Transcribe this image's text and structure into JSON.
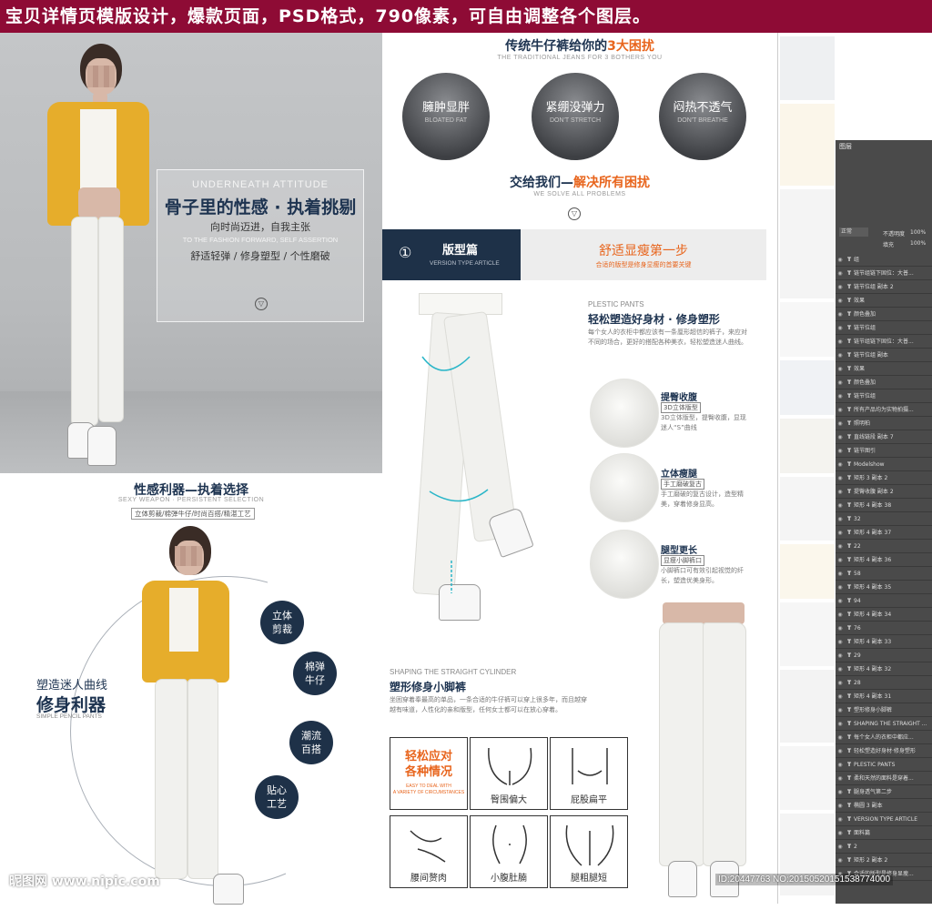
{
  "banner": {
    "text": "宝贝详情页模版设计，爆款页面，PSD格式，790像素，可自由调整各个图层。"
  },
  "hero": {
    "en_title": "UNDERNEATH ATTITUDE",
    "title": "骨子里的性感 · 执着挑剔",
    "sub1": "向时尚迈进，自我主张",
    "en_sub": "TO THE FASHION FORWARD, SELF ASSERTION",
    "sub2": "舒适轻弹 / 修身塑型 / 个性磨破",
    "btn": "▽"
  },
  "problems": {
    "title_a": "传统牛仔裤给你的",
    "title_b": "3大困扰",
    "en": "THE TRADITIONAL JEANS FOR 3 BOTHERS YOU",
    "items": [
      {
        "cn": "臃肿显胖",
        "en": "BLOATED FAT"
      },
      {
        "cn": "紧绷没弹力",
        "en": "DON'T STRETCH"
      },
      {
        "cn": "闷热不透气",
        "en": "DON'T BREATHE"
      }
    ],
    "solve_a": "交给我们—",
    "solve_b": "解决所有困扰",
    "solve_en": "WE SOLVE ALL PROBLEMS",
    "btn": "▽"
  },
  "version": {
    "num": "①",
    "title": "版型篇",
    "en": "VERSION TYPE ARTICLE",
    "right_title": "舒适显瘦第一步",
    "right_sub": "合适的版型是修身显瘦的首要关键"
  },
  "plastic": {
    "en": "PLESTIC PANTS",
    "title": "轻松塑造好身材 · 修身塑形",
    "body": "每个女人的衣柜中都应该有一条厘形超信的裤子，来应对不同的场合，更好的搭配各种美衣，轻松塑造迷人曲线。"
  },
  "details": [
    {
      "title": "提臀收腹",
      "tag": "3D立体版型",
      "body": "3D立体版型，提臀收腹，显现迷人“S”曲线"
    },
    {
      "title": "立体瘦腿",
      "tag": "手工磨破复古",
      "body": "手工磨破的复古设计，造型精美，穿着修身显高。"
    },
    {
      "title": "腿型更长",
      "tag": "显瘦小脚裤口",
      "body": "小脚裤口可有效引起视觉的纤长，塑造优美身形。"
    }
  ],
  "straight": {
    "en": "SHAPING THE STRAIGHT CYLINDER",
    "title": "塑形修身小脚裤",
    "body": "坐困穿着奉最高的单品，一条合适的牛仔裤可以穿上很多年，而且越穿越有味道，人性化的亲和版型，任何女士都可以在放心穿着。"
  },
  "easy": {
    "title1": "轻松应对",
    "title2": "各种情况",
    "en1": "EASY TO DEAL WITH",
    "en2": "A VARIETY OF CIRCUMSTANCES"
  },
  "grid": [
    "臀围偏大",
    "屁股扁平",
    "腰间赘肉",
    "小腹肚腩",
    "腿粗腿短"
  ],
  "sexy": {
    "title": "性感利器—执着选择",
    "en": "SEXY WEAPON · PERSISTENT SELECTION",
    "tag": "立体剪裁/棉弹牛仔/时尚百搭/精湛工艺",
    "curve_cn": "塑造迷人曲线",
    "curve_big": "修身利器",
    "curve_en": "SIMPLE PENCIL PANTS",
    "badges": [
      {
        "l1": "立体",
        "l2": "剪裁"
      },
      {
        "l1": "棉弹",
        "l2": "牛仔"
      },
      {
        "l1": "潮流",
        "l2": "百搭"
      },
      {
        "l1": "贴心",
        "l2": "工艺"
      }
    ]
  },
  "ps_panel": {
    "header": "图层",
    "mode": "正常",
    "opacity_label": "不透明度",
    "opacity": "100%",
    "fill_label": "填充",
    "fill": "100%",
    "layers": [
      "组",
      "链节组链下固位：大普...",
      "链节位组 副本 2",
      "效果",
      "颜色叠加",
      "链节位组",
      "链节组链下固位：大普...",
      "链节位组 副本",
      "效果",
      "颜色叠加",
      "链节位组",
      "所有产品均为实物拍摄...",
      "照明柏",
      "直线链段 副本 7",
      "链节图引",
      "Modelshow",
      "矩形 3 副本 2",
      "提臀收腹 副本 2",
      "矩形 4 副本 38",
      "32",
      "矩形 4 副本 37",
      "22",
      "矩形 4 副本 36",
      "58",
      "矩形 4 副本 35",
      "94",
      "矩形 4 副本 34",
      "76",
      "矩形 4 副本 33",
      "29",
      "矩形 4 副本 32",
      "28",
      "矩形 4 副本 31",
      "塑形修身小脚裤",
      "SHAPING THE STRAIGHT ...",
      "每个女人的衣柜中都应...",
      "轻松塑造好身材·修身塑形",
      "PLESTIC PANTS",
      "柔和天然的面料是穿着...",
      "腿身透气第二步",
      "椭圆 3 副本",
      "VERSION TYPE ARTICLE",
      "面料篇",
      "2",
      "矩形 2 副本 2",
      "合适的版型是修身显瘦..."
    ]
  },
  "watermark": {
    "left": "昵图网 www.nipic.com",
    "right": "ID:20447763 NO:20150520151538774000"
  }
}
